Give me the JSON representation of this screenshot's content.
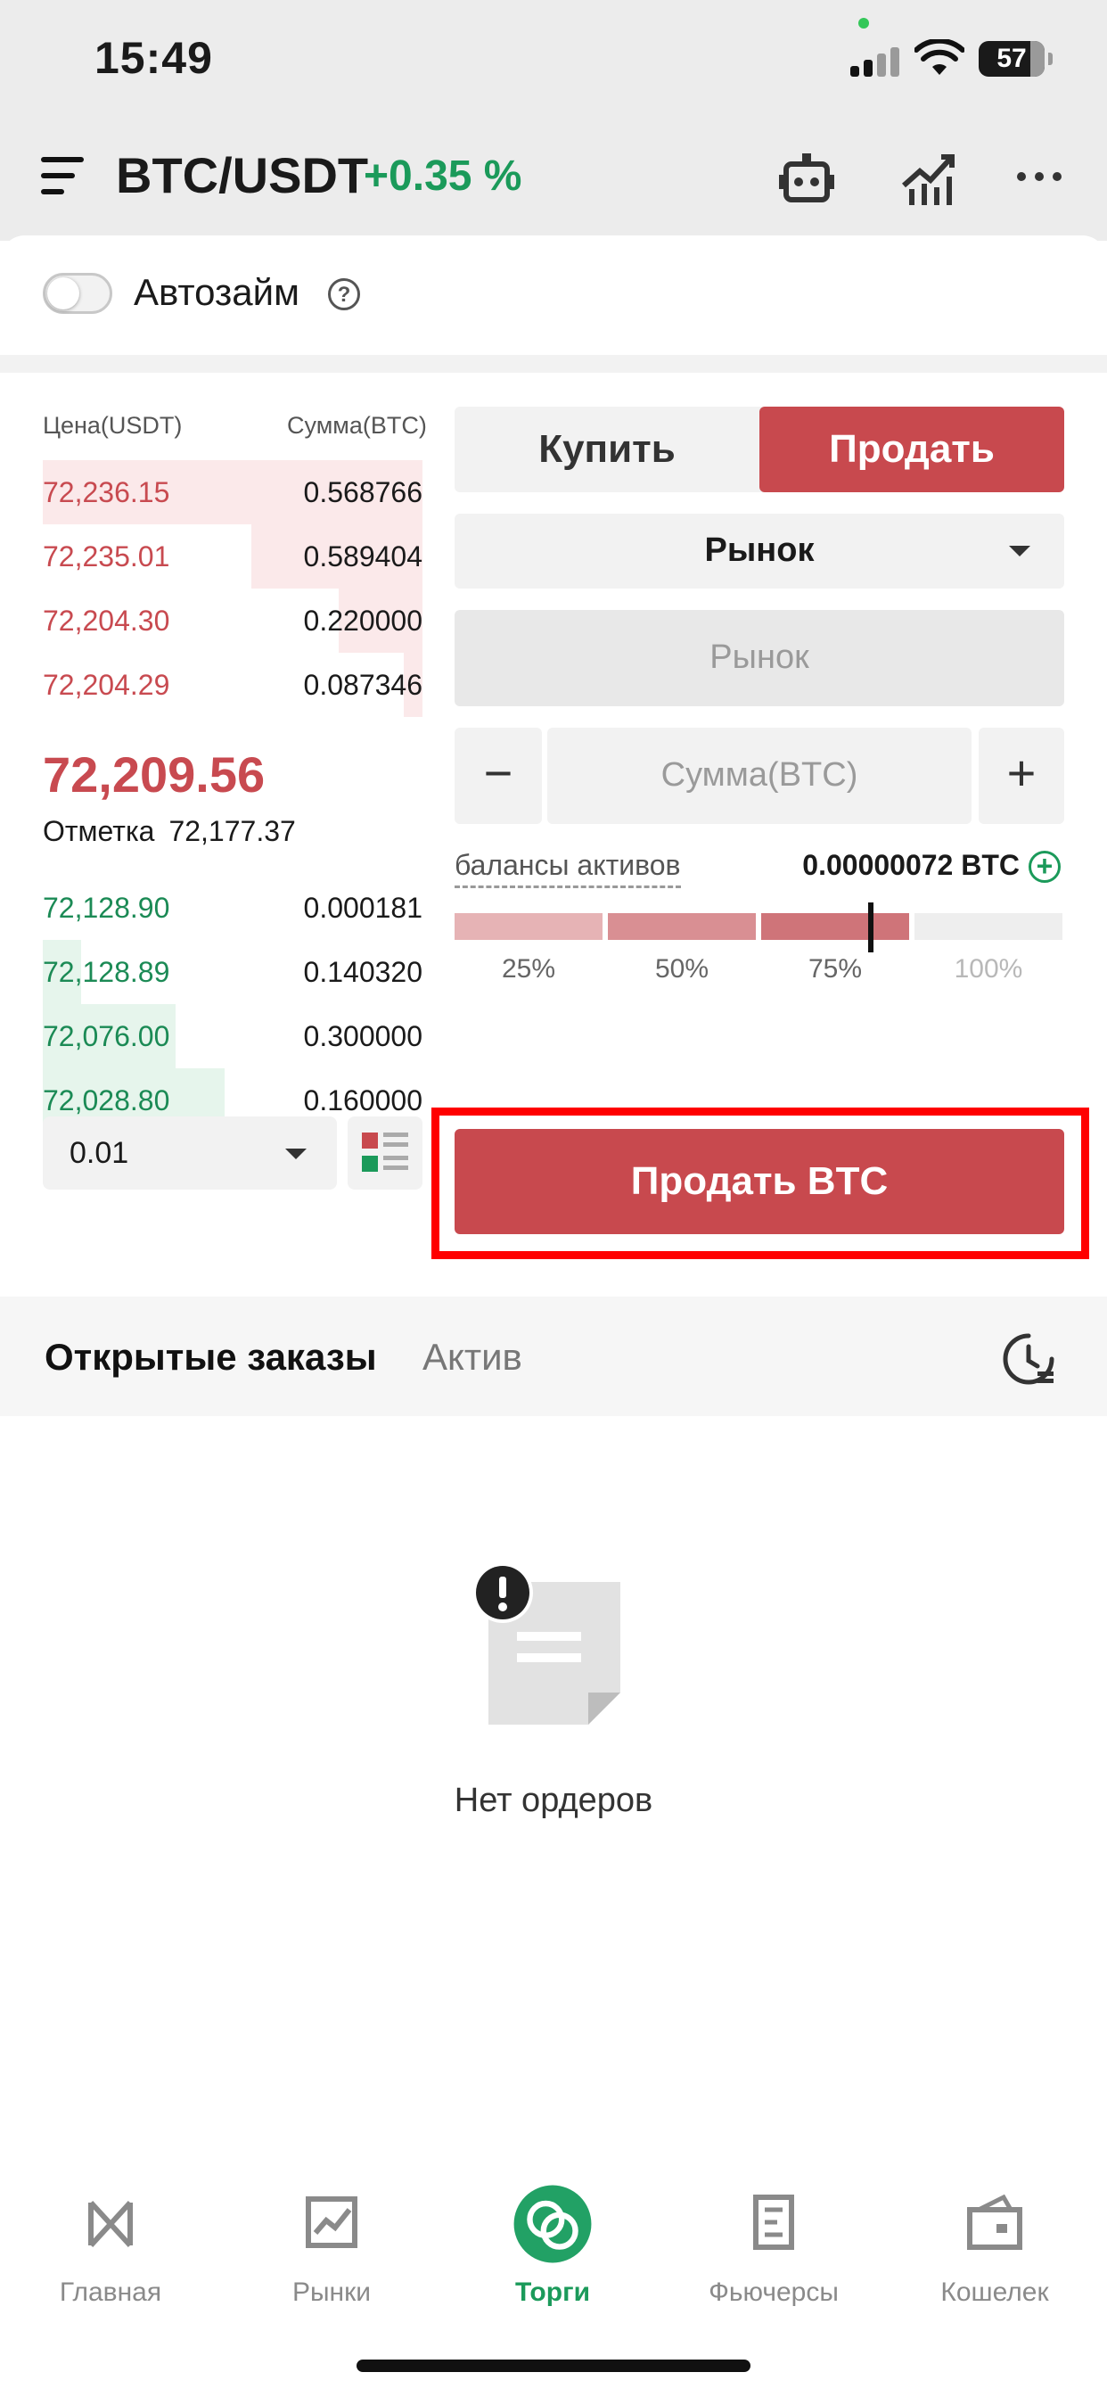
{
  "status_bar": {
    "time": "15:49",
    "battery": "57"
  },
  "header": {
    "pair": "BTC/USDT",
    "change": "+0.35 %"
  },
  "autoloan": {
    "label": "Автозайм",
    "help": "?"
  },
  "order_book": {
    "price_header": "Цена(USDT)",
    "amount_header": "Сумма(BTC)",
    "asks": [
      {
        "price": "72,236.15",
        "amount": "0.568766",
        "depth": 1.0
      },
      {
        "price": "72,235.01",
        "amount": "0.589404",
        "depth": 0.45
      },
      {
        "price": "72,204.30",
        "amount": "0.220000",
        "depth": 0.22
      },
      {
        "price": "72,204.29",
        "amount": "0.087346",
        "depth": 0.05
      }
    ],
    "last_price": "72,209.56",
    "mark_label": "Отметка",
    "mark_price": "72,177.37",
    "bids": [
      {
        "price": "72,128.90",
        "amount": "0.000181",
        "depth": 0.0
      },
      {
        "price": "72,128.89",
        "amount": "0.140320",
        "depth": 0.1
      },
      {
        "price": "72,076.00",
        "amount": "0.300000",
        "depth": 0.35
      },
      {
        "price": "72,028.80",
        "amount": "0.160000",
        "depth": 0.48
      }
    ],
    "step": "0.01"
  },
  "trade": {
    "buy_label": "Купить",
    "sell_label": "Продать",
    "order_type": "Рынок",
    "price_placeholder": "Рынок",
    "amount_placeholder": "Сумма(BTC)",
    "minus": "−",
    "plus": "+",
    "balance_label": "балансы активов",
    "balance_value": "0.00000072 BTC",
    "balance_add": "+",
    "percent_marks": [
      "25%",
      "50%",
      "75%",
      "100%"
    ],
    "slider_value": 0.8,
    "submit_label": "Продать BTC"
  },
  "orders": {
    "tab_open": "Открытые заказы",
    "tab_assets": "Актив",
    "empty_text": "Нет ордеров"
  },
  "nav": {
    "items": [
      {
        "label": "Главная"
      },
      {
        "label": "Рынки"
      },
      {
        "label": "Торги"
      },
      {
        "label": "Фьючерсы"
      },
      {
        "label": "Кошелек"
      }
    ]
  },
  "colors": {
    "sell_red": "#c8494e",
    "buy_green": "#1b9a5a",
    "highlight": "#ff0000"
  }
}
